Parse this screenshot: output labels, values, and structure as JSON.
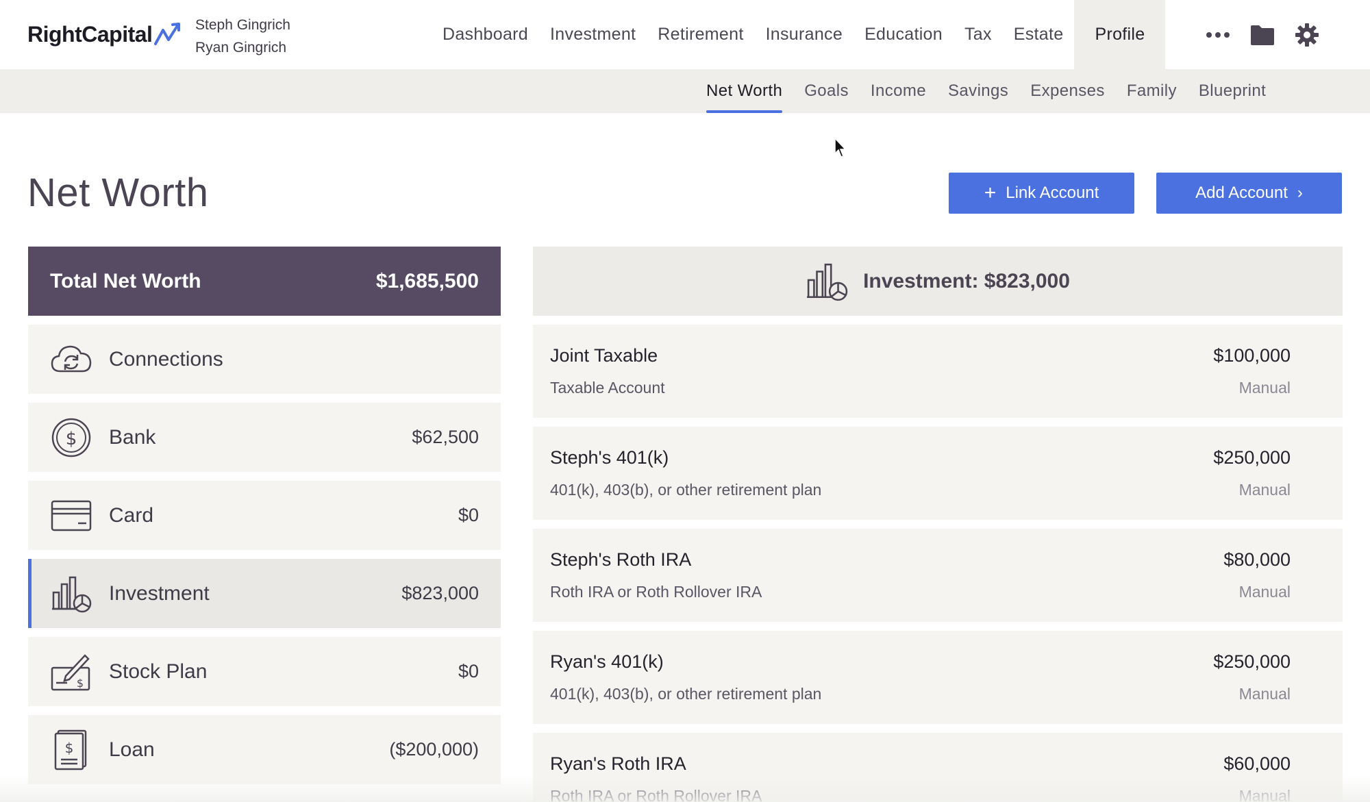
{
  "app": {
    "logo_text": "RightCapital",
    "clients": [
      "Steph Gingrich",
      "Ryan Gingrich"
    ]
  },
  "main_nav": [
    {
      "label": "Dashboard",
      "active": false
    },
    {
      "label": "Investment",
      "active": false
    },
    {
      "label": "Retirement",
      "active": false
    },
    {
      "label": "Insurance",
      "active": false
    },
    {
      "label": "Education",
      "active": false
    },
    {
      "label": "Tax",
      "active": false
    },
    {
      "label": "Estate",
      "active": false
    },
    {
      "label": "Profile",
      "active": true
    }
  ],
  "nav_icons": [
    "more-icon",
    "folder-icon",
    "gear-icon"
  ],
  "sub_nav": [
    {
      "label": "Net Worth",
      "active": true
    },
    {
      "label": "Goals",
      "active": false
    },
    {
      "label": "Income",
      "active": false
    },
    {
      "label": "Savings",
      "active": false
    },
    {
      "label": "Expenses",
      "active": false
    },
    {
      "label": "Family",
      "active": false
    },
    {
      "label": "Blueprint",
      "active": false
    }
  ],
  "page": {
    "title": "Net Worth",
    "link_account_label": "Link Account",
    "add_account_label": "Add Account"
  },
  "summary": {
    "total_label": "Total Net Worth",
    "total_value": "$1,685,500",
    "categories": [
      {
        "label": "Connections",
        "value": "",
        "icon": "cloud-sync-icon",
        "selected": false
      },
      {
        "label": "Bank",
        "value": "$62,500",
        "icon": "dollar-coin-icon",
        "selected": false
      },
      {
        "label": "Card",
        "value": "$0",
        "icon": "credit-card-icon",
        "selected": false
      },
      {
        "label": "Investment",
        "value": "$823,000",
        "icon": "investment-chart-icon",
        "selected": true
      },
      {
        "label": "Stock Plan",
        "value": "$0",
        "icon": "stock-plan-icon",
        "selected": false
      },
      {
        "label": "Loan",
        "value": "($200,000)",
        "icon": "loan-document-icon",
        "selected": false
      }
    ]
  },
  "detail": {
    "header": "Investment: $823,000",
    "accounts": [
      {
        "name": "Joint Taxable",
        "type": "Taxable Account",
        "value": "$100,000",
        "source": "Manual"
      },
      {
        "name": "Steph's 401(k)",
        "type": "401(k), 403(b), or other retirement plan",
        "value": "$250,000",
        "source": "Manual"
      },
      {
        "name": "Steph's Roth IRA",
        "type": "Roth IRA or Roth Rollover IRA",
        "value": "$80,000",
        "source": "Manual"
      },
      {
        "name": "Ryan's 401(k)",
        "type": "401(k), 403(b), or other retirement plan",
        "value": "$250,000",
        "source": "Manual"
      },
      {
        "name": "Ryan's Roth IRA",
        "type": "Roth IRA or Roth Rollover IRA",
        "value": "$60,000",
        "source": "Manual"
      }
    ]
  },
  "colors": {
    "accent": "#4b71e0",
    "total_bar": "#564b63",
    "panel": "#f6f4f0"
  }
}
